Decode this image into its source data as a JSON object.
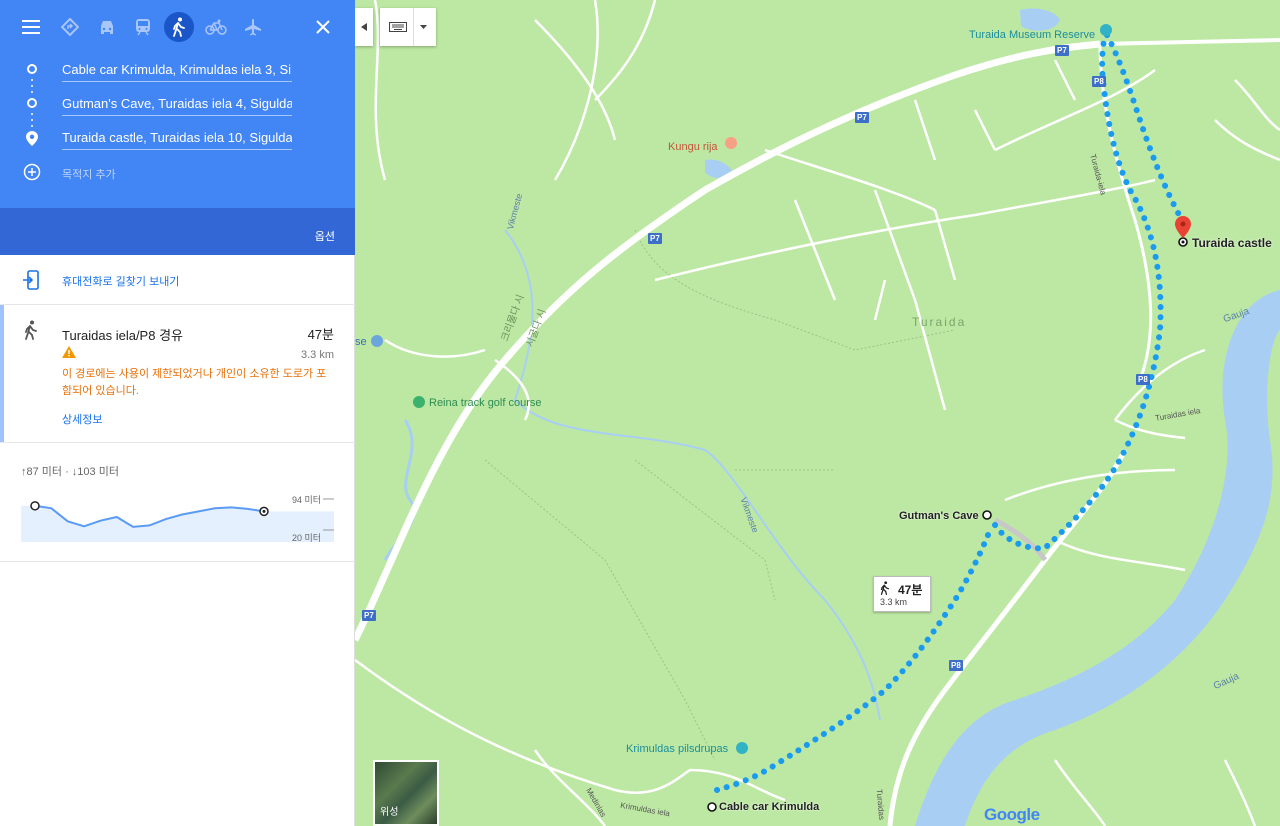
{
  "panel": {
    "waypoints": [
      {
        "label": "Cable car Krimulda, Krimuldas iela 3, Si"
      },
      {
        "label": "Gutman's Cave, Turaidas iela 4, Sigulda,"
      },
      {
        "label": "Turaida castle, Turaidas iela 10, Sigulda"
      }
    ],
    "add_destination": "목적지 추가",
    "options_label": "옵션",
    "send_to_phone": "휴대전화로 길찾기 보내기",
    "route": {
      "via": "Turaidas iela/P8 경유",
      "duration": "47분",
      "distance": "3.3 km",
      "warning": "이 경로에는 사용이 제한되었거나 개인이 소유한 도로가 포함되어 있습니다.",
      "details_link": "상세정보"
    },
    "elevation": {
      "summary": "↑87 미터 · ↓103 미터",
      "max_label": "94 미터",
      "min_label": "20 미터",
      "profile": [
        0.78,
        0.7,
        0.28,
        0.12,
        0.3,
        0.42,
        0.1,
        0.15,
        0.35,
        0.5,
        0.6,
        0.7,
        0.73,
        0.68,
        0.6
      ]
    }
  },
  "map": {
    "places": {
      "turaida_museum": "Turaida Museum Reserve",
      "kungu_rija": "Kungu rija",
      "turaida": "Turaida",
      "reina_golf": "Reina track golf course",
      "gutmans_cave": "Gutman's Cave",
      "turaida_castle": "Turaida castle",
      "cable_car": "Cable car Krimulda",
      "krimuldas_pilsdrupas": "Krimuldas pilsdrupas",
      "gauja": "Gauja",
      "gauja2": "Gauja",
      "vikmeste": "Vikmeste",
      "vikmeste2": "Vikmeste",
      "krimuldas_iela": "Krimuldas iela",
      "turaidas_iela": "Turaidas iela",
      "turaidas_iela2": "Turaidas",
      "turaidas_iela_vert": "Turaida-iela",
      "medinlas": "Medinlas",
      "se": "se",
      "kr_sigulda_1": "크리물다 시",
      "kr_sigulda_2": "시굴다 시"
    },
    "road_shields": [
      "P7",
      "P7",
      "P7",
      "P7",
      "P8",
      "P8",
      "P8"
    ],
    "route_callout": {
      "duration": "47분",
      "distance": "3.3 km"
    },
    "satellite_label": "위성",
    "google_logo": "Google",
    "colors": {
      "route": "#1a9bf0",
      "water": "#a8cff3",
      "land": "#bde8a3",
      "road": "#ffffff"
    }
  }
}
